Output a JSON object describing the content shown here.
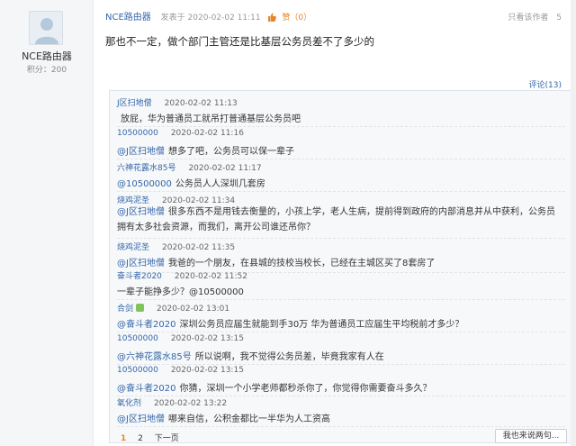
{
  "user": {
    "name": "NCE路由器",
    "points_label": "积分：200"
  },
  "post": {
    "author": "NCE路由器",
    "time": "发表于 2020-02-02 11:11",
    "like_label": "赞（0）",
    "only_author": "只看该作者",
    "floor": "5",
    "body": "那也不一定，做个部门主管还是比基层公务员差不了多少的",
    "comment_count": "评论(13)"
  },
  "replies": [
    {
      "user": "J区扫地僧",
      "time": "2020-02-02 11:13",
      "mention": "",
      "text": "放屁，华为普通员工就吊打普通基层公务员吧"
    },
    {
      "user": "10500000",
      "time": "2020-02-02 11:16",
      "mention": "@J区扫地僧",
      "text": "想多了吧，公务员可以保一辈子"
    },
    {
      "user": "六神花露水85号",
      "time": "2020-02-02 11:17",
      "mention": "@10500000",
      "text": "公务员人人深圳几套房"
    },
    {
      "user": "烧鸡泥圣",
      "time": "2020-02-02 11:34",
      "mention": "@J区扫地僧",
      "text": "很多东西不是用钱去衡量的，小孩上学，老人生病，提前得到政府的内部消息并从中获利，公务员拥有太多社会资源，而我们，离开公司谁还吊你？"
    },
    {
      "user": "烧鸡泥圣",
      "time": "2020-02-02 11:35",
      "mention": "@J区扫地僧",
      "text": "我爸的一个朋友，在县城的技校当校长，已经在主城区买了8套房了"
    },
    {
      "user": "奋斗者2020",
      "time": "2020-02-02 11:52",
      "mention": "",
      "text": "一辈子能挣多少？@10500000"
    },
    {
      "user": "合剑",
      "time": "2020-02-02 13:01",
      "mention": "@奋斗者2020",
      "text": "深圳公务员应届生就能到手30万 华为普通员工应届生平均税前才多少？"
    },
    {
      "user": "10500000",
      "time": "2020-02-02 13:15",
      "mention": "@六神花露水85号",
      "text": "所以说啊，我不觉得公务员差，毕竟我家有人在"
    },
    {
      "user": "10500000",
      "time": "2020-02-02 13:15",
      "mention": "@奋斗者2020",
      "text": "你猜，深圳一个小学老师都秒杀你了，你觉得你需要奋斗多久？"
    },
    {
      "user": "氧化剂",
      "time": "2020-02-02 13:22",
      "mention": "@J区扫地僧",
      "text": "哪来自信，公积金都比一半华为人工资高"
    }
  ],
  "pager": {
    "pages": [
      "1",
      "2"
    ],
    "next": "下一页"
  },
  "say_button": "我也来说两句..."
}
